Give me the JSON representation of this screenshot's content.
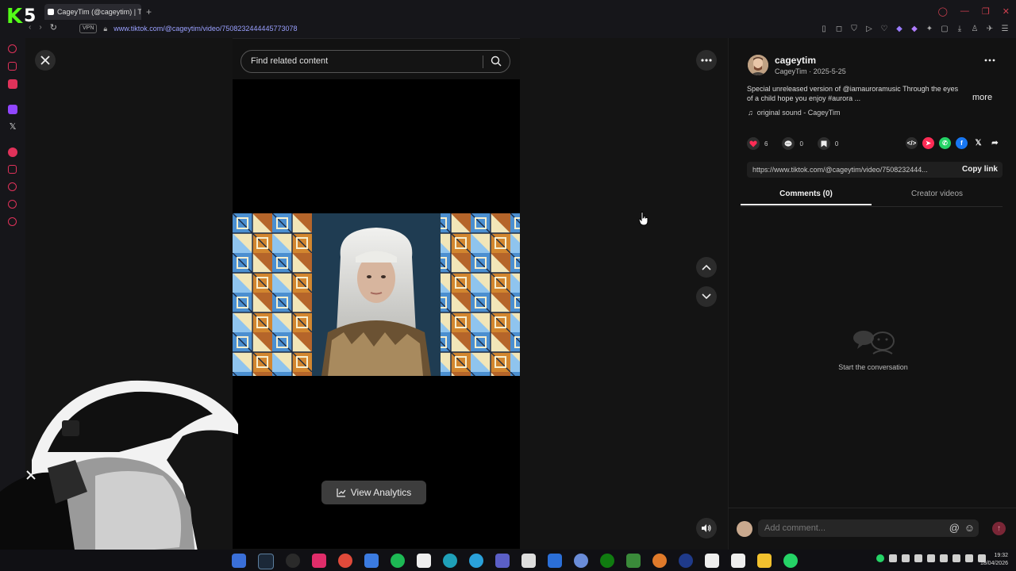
{
  "browser": {
    "logo_letter": "K",
    "logo_number": "5",
    "tab_title": "CageyTim (@cageytim) | T",
    "new_tab": "+",
    "vpn_label": "VPN",
    "url": "www.tiktok.com/@cageytim/video/7508232444445773078"
  },
  "search": {
    "placeholder": "Find related content"
  },
  "video": {
    "analytics_label": "View Analytics"
  },
  "post": {
    "username": "cageytim",
    "display_name_date": "CageyTim · 2025-5-25",
    "caption": "Special unreleased version of @iamauroramusic Through the eyes of a child hope you enjoy #aurora ...",
    "more_label": "more",
    "sound": "original sound - CageyTim",
    "likes": "6",
    "comments": "0",
    "saves": "0",
    "link_url": "https://www.tiktok.com/@cageytim/video/7508232444...",
    "copy_link_label": "Copy link"
  },
  "tabs": {
    "comments": "Comments (0)",
    "creator_videos": "Creator videos"
  },
  "empty_state": {
    "text": "Start the conversation"
  },
  "comment_input": {
    "placeholder": "Add comment..."
  },
  "taskbar": {
    "time": "19:32",
    "date": "18/04/2026"
  },
  "colors": {
    "accent_like": "#fe2c55",
    "kick_green": "#53fc18",
    "url_blue": "#9aa0ff"
  }
}
